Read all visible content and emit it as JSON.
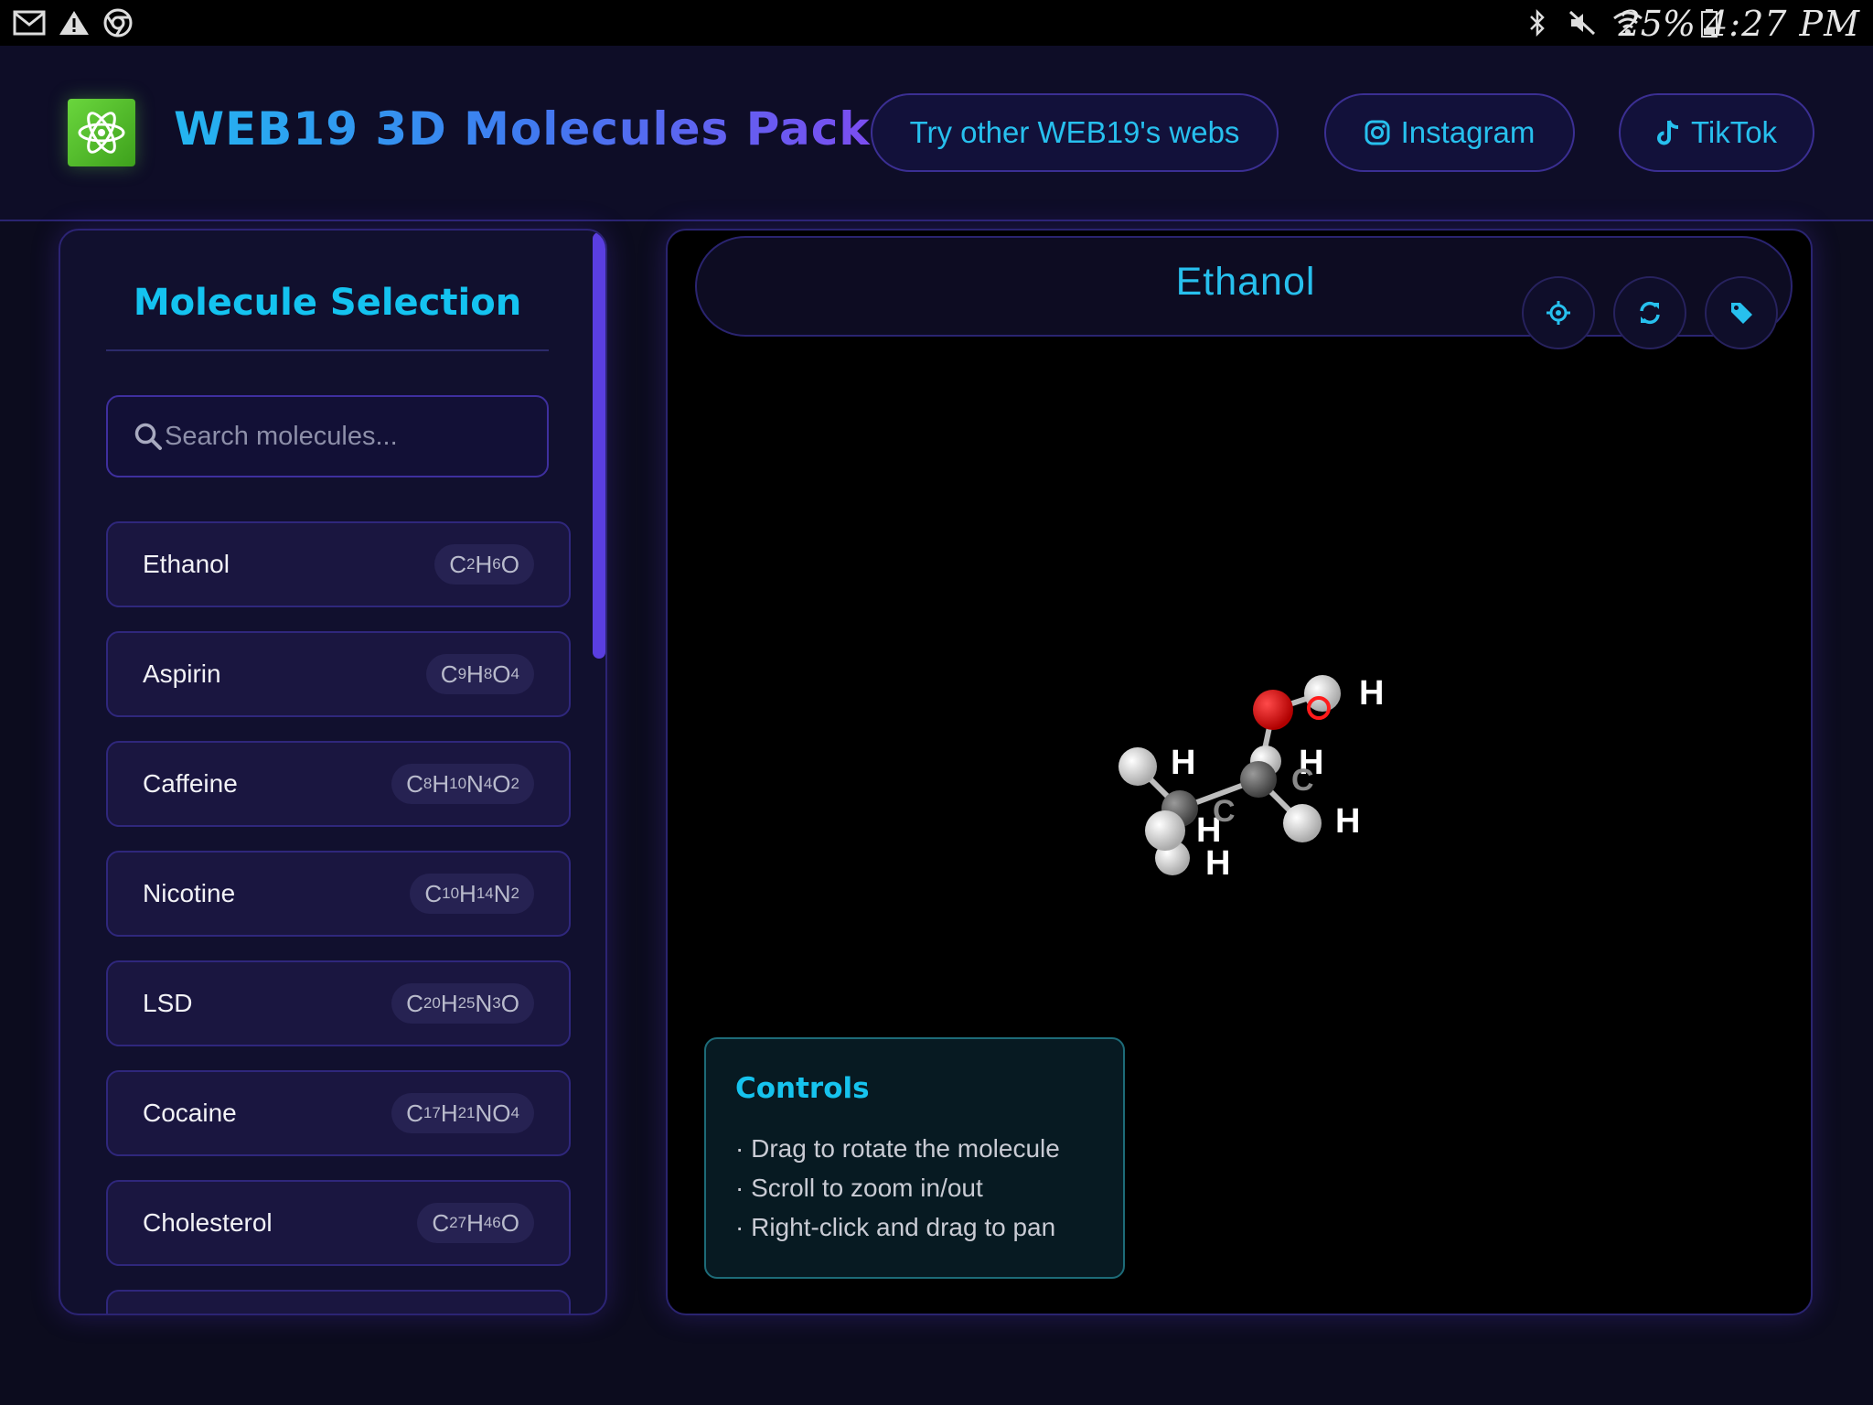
{
  "status_bar": {
    "left_icons": [
      "gmail-icon",
      "warning-icon",
      "chrome-icon"
    ],
    "right_icons": [
      "bluetooth-icon",
      "mute-icon",
      "wifi-icon",
      "battery-icon"
    ],
    "battery": "25%",
    "time": "4:27 PM"
  },
  "header": {
    "logo_icon": "atom-icon",
    "title": "WEB19 3D Molecules Pack",
    "links": [
      {
        "label": "Try other WEB19's webs",
        "icon": ""
      },
      {
        "label": "Instagram",
        "icon": "instagram-icon"
      },
      {
        "label": "TikTok",
        "icon": "tiktok-icon"
      }
    ],
    "accent": "#27c0ee"
  },
  "sidebar": {
    "title": "Molecule Selection",
    "search_placeholder": "Search molecules...",
    "molecules": [
      {
        "name": "Ethanol",
        "formula": [
          [
            "C",
            "2"
          ],
          [
            "H",
            "6"
          ],
          [
            "O",
            ""
          ]
        ]
      },
      {
        "name": "Aspirin",
        "formula": [
          [
            "C",
            "9"
          ],
          [
            "H",
            "8"
          ],
          [
            "O",
            "4"
          ]
        ]
      },
      {
        "name": "Caffeine",
        "formula": [
          [
            "C",
            "8"
          ],
          [
            "H",
            "10"
          ],
          [
            "N",
            "4"
          ],
          [
            "O",
            "2"
          ]
        ]
      },
      {
        "name": "Nicotine",
        "formula": [
          [
            "C",
            "10"
          ],
          [
            "H",
            "14"
          ],
          [
            "N",
            "2"
          ]
        ]
      },
      {
        "name": "LSD",
        "formula": [
          [
            "C",
            "20"
          ],
          [
            "H",
            "25"
          ],
          [
            "N",
            "3"
          ],
          [
            "O",
            ""
          ]
        ]
      },
      {
        "name": "Cocaine",
        "formula": [
          [
            "C",
            "17"
          ],
          [
            "H",
            "21"
          ],
          [
            "N",
            ""
          ],
          [
            "O",
            "4"
          ]
        ]
      },
      {
        "name": "Cholesterol",
        "formula": [
          [
            "C",
            "27"
          ],
          [
            "H",
            "46"
          ],
          [
            "O",
            ""
          ]
        ]
      }
    ]
  },
  "viewer": {
    "title": "Ethanol",
    "buttons": [
      "crosshair-icon",
      "refresh-icon",
      "tag-icon"
    ],
    "atom_labels": [
      "H",
      "H",
      "H",
      "H",
      "H",
      "H",
      "C",
      "C"
    ],
    "controls": {
      "title": "Controls",
      "items": [
        "· Drag to rotate the molecule",
        "· Scroll to zoom in/out",
        "· Right-click and drag to pan"
      ]
    }
  }
}
